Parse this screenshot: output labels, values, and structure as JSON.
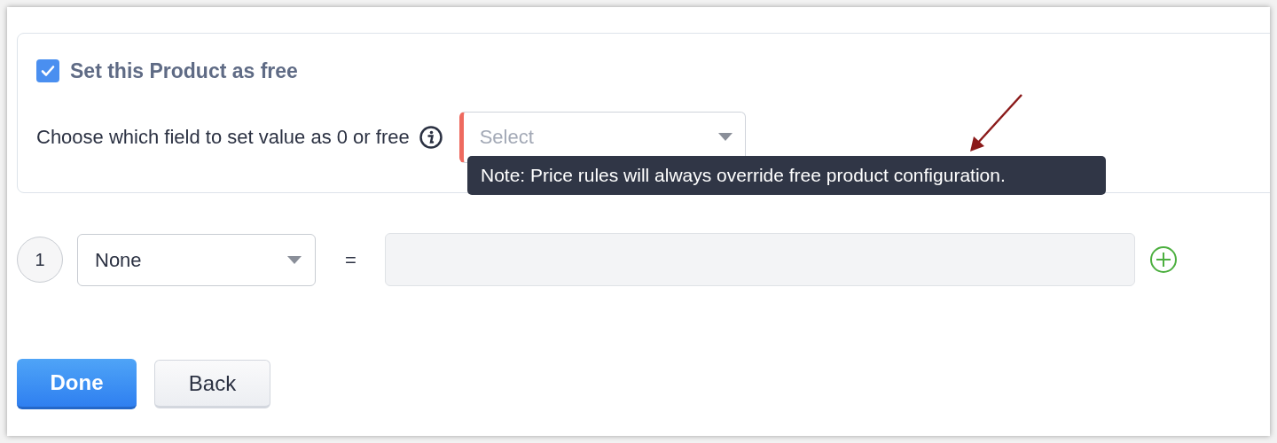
{
  "free_product": {
    "checked": true,
    "label": "Set this Product as free"
  },
  "field_choice": {
    "label": "Choose which field to set value as 0 or free",
    "placeholder": "Select",
    "required": true
  },
  "tooltip": "Note: Price rules will always override free product configuration.",
  "rows": [
    {
      "number": "1",
      "field": "None",
      "operator": "=",
      "value": ""
    }
  ],
  "buttons": [
    {
      "label": "Done",
      "kind": "primary"
    },
    {
      "label": "Back",
      "kind": "secondary"
    }
  ]
}
